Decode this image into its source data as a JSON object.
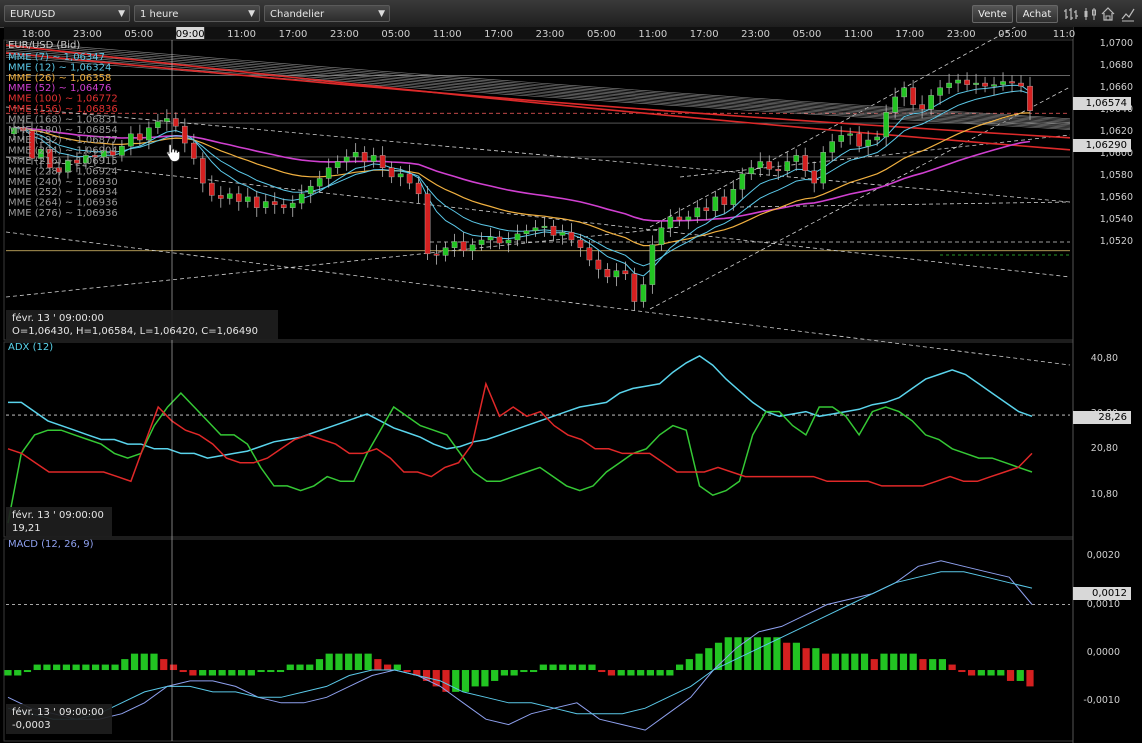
{
  "toolbar": {
    "symbol": "EUR/USD",
    "timeframe": "1 heure",
    "chart_type": "Chandelier",
    "sell_label": "Vente",
    "buy_label": "Achat"
  },
  "time_axis": [
    "18:00",
    "23:00",
    "05:00",
    "09:00",
    "11:00",
    "17:00",
    "23:00",
    "05:00",
    "11:00",
    "17:00",
    "23:00",
    "05:00",
    "11:00",
    "17:00",
    "23:00",
    "05:00",
    "11:00",
    "17:00",
    "23:00",
    "05:00",
    "11:0"
  ],
  "time_axis_highlight": "09:00",
  "main_panel": {
    "symbol_label": "EUR/USD (Bid)",
    "legend": [
      {
        "text": "MME (7) ~ 1,06347",
        "color": "#5bc8e8"
      },
      {
        "text": "MME (12) ~ 1,06324",
        "color": "#5bc8e8"
      },
      {
        "text": "MME (26) ~ 1,06358",
        "color": "#f0b040"
      },
      {
        "text": "MME (52) ~ 1,06476",
        "color": "#d040d0"
      },
      {
        "text": "MME (100) ~ 1,06772",
        "color": "#e03030"
      },
      {
        "text": "MME (156) ~ 1,06836",
        "color": "#e03030"
      },
      {
        "text": "MME (168) ~ 1,06831",
        "color": "#9a9a9a"
      },
      {
        "text": "MME (180) ~ 1,06854",
        "color": "#9a9a9a"
      },
      {
        "text": "MME (192) ~ 1,06877",
        "color": "#9a9a9a"
      },
      {
        "text": "MME (204) ~ 1,06904",
        "color": "#9a9a9a"
      },
      {
        "text": "MME (216) ~ 1,06915",
        "color": "#9a9a9a"
      },
      {
        "text": "MME (228) ~ 1,06924",
        "color": "#9a9a9a"
      },
      {
        "text": "MME (240) ~ 1,06930",
        "color": "#9a9a9a"
      },
      {
        "text": "MME (252) ~ 1,06934",
        "color": "#9a9a9a"
      },
      {
        "text": "MME (264) ~ 1,06936",
        "color": "#9a9a9a"
      },
      {
        "text": "MME (276) ~ 1,06936",
        "color": "#9a9a9a"
      }
    ],
    "info_date": "févr. 13 ' 09:00:00",
    "info_ohlc": "O=1,06430, H=1,06584, L=1,06420, C=1,06490",
    "y_ticks": [
      "1,0700",
      "1,0680",
      "1,0660",
      "1,0640",
      "1,0620",
      "1,0600",
      "1,0580",
      "1,0560",
      "1,0540",
      "1,0520"
    ],
    "price_labels": [
      "1,06574",
      "1,06290"
    ]
  },
  "adx_panel": {
    "title": "ADX (12)",
    "info_date": "févr. 13 ' 09:00:00",
    "info_value": "19,21",
    "y_ticks": [
      "40,80",
      "30,80",
      "20,80",
      "10,80"
    ],
    "level_label": "28,26"
  },
  "macd_panel": {
    "title": "MACD (12, 26, 9)",
    "info_date": "févr. 13 ' 09:00:00",
    "info_value": "-0,0003",
    "y_ticks": [
      "0,0020",
      "0,0010",
      "0,0000",
      "-0,0010"
    ],
    "level_label": "0,0012"
  },
  "colors": {
    "up": "#22c422",
    "down": "#d42020",
    "adx": "#5ad4ec",
    "di_plus": "#35c835",
    "di_minus": "#e02828",
    "macd": "#8ea0ee",
    "signal": "#5ac8e8"
  },
  "chart_data": [
    {
      "type": "candlestick",
      "title": "EUR/USD",
      "ylim": [
        1.051,
        1.0705
      ],
      "close": [
        1.0648,
        1.0646,
        1.0628,
        1.0634,
        1.0622,
        1.0619,
        1.0627,
        1.0625,
        1.063,
        1.0629,
        1.0633,
        1.063,
        1.0636,
        1.0644,
        1.064,
        1.0648,
        1.0652,
        1.0654,
        1.0649,
        1.0638,
        1.0628,
        1.0612,
        1.0604,
        1.0602,
        1.0605,
        1.06,
        1.0603,
        1.0596,
        1.06,
        1.0598,
        1.0596,
        1.0599,
        1.0605,
        1.061,
        1.0615,
        1.0622,
        1.0626,
        1.0629,
        1.0632,
        1.0626,
        1.063,
        1.0622,
        1.0616,
        1.0618,
        1.0612,
        1.0605,
        1.0566,
        1.0565,
        1.057,
        1.0574,
        1.0568,
        1.0572,
        1.0575,
        1.0577,
        1.0573,
        1.0575,
        1.0579,
        1.0581,
        1.0583,
        1.0584,
        1.0578,
        1.058,
        1.0575,
        1.057,
        1.0562,
        1.0556,
        1.0551,
        1.0555,
        1.0553,
        1.0535,
        1.0546,
        1.0572,
        1.0583,
        1.059,
        1.0588,
        1.059,
        1.0596,
        1.0594,
        1.0603,
        1.0598,
        1.0608,
        1.0618,
        1.0622,
        1.0626,
        1.0621,
        1.062,
        1.0626,
        1.063,
        1.062,
        1.0612,
        1.0632,
        1.0639,
        1.0643,
        1.0644,
        1.0636,
        1.064,
        1.0642,
        1.0658,
        1.0668,
        1.0674,
        1.0663,
        1.066,
        1.0669,
        1.0674,
        1.0677,
        1.0679,
        1.0676,
        1.0677,
        1.0675,
        1.0676,
        1.0678,
        1.0677,
        1.0675,
        1.0659
      ],
      "highlighted_bar": {
        "date": "févr. 13 ' 09:00:00",
        "open": 1.0643,
        "high": 1.06584,
        "low": 1.0642,
        "close": 1.0649
      },
      "series": [
        {
          "name": "MME (7)",
          "last": 1.06347
        },
        {
          "name": "MME (12)",
          "last": 1.06324
        },
        {
          "name": "MME (26)",
          "last": 1.06358
        },
        {
          "name": "MME (52)",
          "last": 1.06476
        },
        {
          "name": "MME (100)",
          "last": 1.06772
        },
        {
          "name": "MME (156)",
          "last": 1.06836
        }
      ],
      "horizontal_levels": [
        1.0682,
        1.06574,
        1.0651,
        1.0629,
        1.0568
      ],
      "y_ticks": [
        1.07,
        1.068,
        1.066,
        1.064,
        1.062,
        1.06,
        1.058,
        1.056,
        1.054,
        1.052
      ]
    },
    {
      "type": "line",
      "title": "ADX (12)",
      "ylim": [
        2,
        44
      ],
      "level": 28.26,
      "series": [
        {
          "name": "ADX",
          "values": [
            31,
            31,
            29,
            27,
            26,
            25,
            24,
            23,
            23,
            22,
            22,
            21,
            21,
            20,
            20,
            19,
            19.5,
            20,
            20.5,
            21.5,
            22.5,
            23,
            23.5,
            24.5,
            25.5,
            26.5,
            27.5,
            28.5,
            27,
            25.5,
            24.5,
            23.5,
            22,
            21,
            21.5,
            22.5,
            23,
            24,
            25,
            26,
            27,
            28,
            29,
            30,
            30.5,
            31,
            33,
            34,
            34.5,
            35,
            37.5,
            39.5,
            41,
            39,
            36,
            33.5,
            31,
            29,
            28,
            28.5,
            29,
            28,
            28.5,
            29,
            29.5,
            30.5,
            31,
            32,
            34,
            36,
            37,
            38,
            37,
            35,
            33,
            31,
            29,
            28
          ]
        },
        {
          "name": "DI+",
          "values": [
            5,
            20,
            24,
            25,
            25,
            24,
            23,
            22,
            20,
            19,
            20,
            26,
            30,
            33,
            30,
            27,
            24,
            24,
            22,
            17,
            13,
            13,
            12,
            13,
            15,
            14,
            14,
            20,
            25,
            30,
            28,
            26,
            25,
            24,
            20,
            16,
            14,
            14,
            15,
            16,
            17,
            15,
            13,
            12,
            13,
            16,
            18,
            20,
            21,
            24,
            26,
            25,
            13,
            11,
            12,
            14,
            24,
            29,
            29,
            26,
            24,
            30,
            30,
            28,
            24,
            29,
            30,
            29,
            27,
            24,
            23,
            21,
            20,
            19,
            19,
            18,
            17,
            16
          ]
        },
        {
          "name": "DI-",
          "values": [
            21,
            20,
            18,
            16,
            16,
            16,
            16,
            16,
            15,
            14,
            22,
            30,
            27,
            25,
            24,
            22,
            19,
            18,
            18,
            19,
            21,
            23,
            24,
            23,
            22,
            20,
            20,
            21,
            19,
            16,
            16,
            15,
            17,
            18,
            22,
            35,
            28,
            30,
            28,
            29,
            26,
            24,
            23,
            21,
            21,
            20,
            20,
            20,
            18,
            16,
            16,
            16,
            17,
            16,
            15,
            15,
            15,
            15,
            15,
            15,
            14,
            14,
            14,
            14,
            13,
            13,
            13,
            13,
            14,
            15,
            14,
            14,
            15,
            16,
            17,
            20
          ]
        }
      ]
    },
    {
      "type": "bar",
      "title": "MACD (12, 26, 9)",
      "ylim": [
        -0.0013,
        0.0024
      ],
      "level": 0.0012,
      "histogram": [
        -0.0001,
        -0.0001,
        0.0,
        0.0001,
        0.0001,
        0.0001,
        0.0001,
        0.0001,
        0.0001,
        0.0001,
        0.0001,
        0.0001,
        0.0002,
        0.0003,
        0.0003,
        0.0003,
        0.0002,
        0.0001,
        0.0,
        -0.0001,
        -0.0001,
        -0.0001,
        -0.0001,
        -0.0001,
        -0.0001,
        -0.0001,
        0.0,
        0.0,
        0.0,
        0.0001,
        0.0001,
        0.0001,
        0.0002,
        0.0003,
        0.0003,
        0.0003,
        0.0003,
        0.0003,
        0.0002,
        0.0001,
        0.0001,
        0.0,
        -0.0001,
        -0.0002,
        -0.0003,
        -0.0004,
        -0.0004,
        -0.0004,
        -0.0003,
        -0.0003,
        -0.0002,
        -0.0001,
        -0.0001,
        0.0,
        0.0,
        0.0001,
        0.0001,
        0.0001,
        0.0001,
        0.0001,
        0.0001,
        0.0,
        -0.0001,
        -0.0001,
        -0.0001,
        -0.0001,
        -0.0001,
        -0.0001,
        -0.0001,
        0.0001,
        0.0002,
        0.0003,
        0.0004,
        0.0005,
        0.0006,
        0.0006,
        0.0006,
        0.0006,
        0.0006,
        0.0006,
        0.0005,
        0.0005,
        0.0004,
        0.0004,
        0.0003,
        0.0003,
        0.0003,
        0.0003,
        0.0003,
        0.0002,
        0.0003,
        0.0003,
        0.0003,
        0.0003,
        0.0002,
        0.0002,
        0.0002,
        0.0001,
        0.0,
        -0.0001,
        -0.0001,
        -0.0001,
        -0.0001,
        -0.0002,
        -0.0002,
        -0.0003
      ],
      "series": [
        {
          "name": "MACD",
          "values": [
            -0.0005,
            -0.0007,
            -0.0008,
            -0.0009,
            -0.0009,
            -0.0008,
            -0.0006,
            -0.0003,
            -0.0002,
            -0.0002,
            -0.0003,
            -0.0005,
            -0.0006,
            -0.0006,
            -0.0005,
            -0.0003,
            -0.0001,
            0.0,
            -0.0001,
            -0.0003,
            -0.0006,
            -0.0009,
            -0.001,
            -0.0008,
            -0.0007,
            -0.0006,
            -0.0009,
            -0.001,
            -0.0011,
            -0.0008,
            -0.0005,
            0.0,
            0.0004,
            0.0007,
            0.0008,
            0.001,
            0.0012,
            0.0013,
            0.0014,
            0.0016,
            0.0019,
            0.002,
            0.0019,
            0.0018,
            0.0017,
            0.0012
          ]
        },
        {
          "name": "Signal",
          "values": [
            -0.0007,
            -0.0008,
            -0.0009,
            -0.0009,
            -0.0008,
            -0.0006,
            -0.0004,
            -0.0003,
            -0.0003,
            -0.0004,
            -0.0004,
            -0.0005,
            -0.0005,
            -0.0004,
            -0.0003,
            -0.0001,
            0.0,
            0.0,
            -0.0001,
            -0.0002,
            -0.0004,
            -0.0005,
            -0.0006,
            -0.0006,
            -0.0007,
            -0.0008,
            -0.0008,
            -0.0008,
            -0.0007,
            -0.0005,
            -0.0003,
            0.0,
            0.0002,
            0.0004,
            0.0006,
            0.0008,
            0.001,
            0.0012,
            0.0014,
            0.0016,
            0.0017,
            0.0018,
            0.0018,
            0.0017,
            0.0016,
            0.0015
          ]
        }
      ]
    }
  ]
}
